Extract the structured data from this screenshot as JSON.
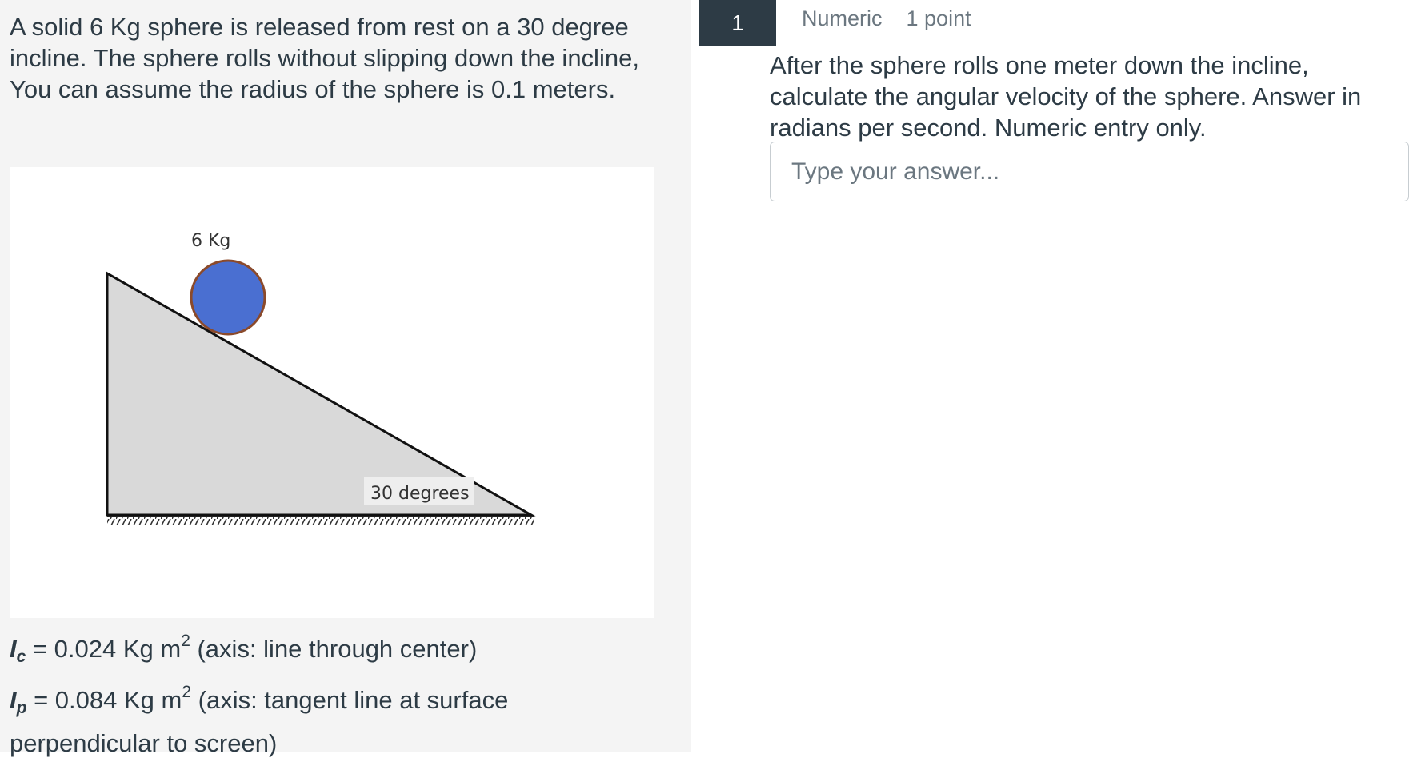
{
  "stimulus": {
    "paragraphs": [
      "A solid 6 Kg sphere is released from rest on a 30 degree incline.  The sphere rolls without slipping down the incline,",
      "You can assume the radius of the sphere is 0.1 meters."
    ],
    "figure": {
      "mass_label": "6 Kg",
      "angle_label": "30 degrees",
      "colors": {
        "sphere": "#4a6fd1",
        "sphere_outline": "#8b4a2b",
        "incline": "#d9d9d9"
      }
    },
    "moments": {
      "ic_symbol": "I",
      "ic_sub": "c",
      "ic_value": " = 0.024 Kg m",
      "ic_exp": "2",
      "ic_axis": " (axis: line through center)",
      "ip_symbol": "I",
      "ip_sub": "p",
      "ip_value": " = 0.084 Kg m",
      "ip_exp": "2",
      "ip_axis": " (axis: tangent line at surface",
      "ip_axis_cont": "perpendicular to screen)"
    }
  },
  "question": {
    "number": "1",
    "type": "Numeric",
    "points": "1 point",
    "prompt": "After the sphere rolls one meter down the incline, calculate the angular velocity of the sphere.  Answer in radians per second.  Numeric entry only.",
    "answer_placeholder": "Type your answer...",
    "answer_value": ""
  }
}
